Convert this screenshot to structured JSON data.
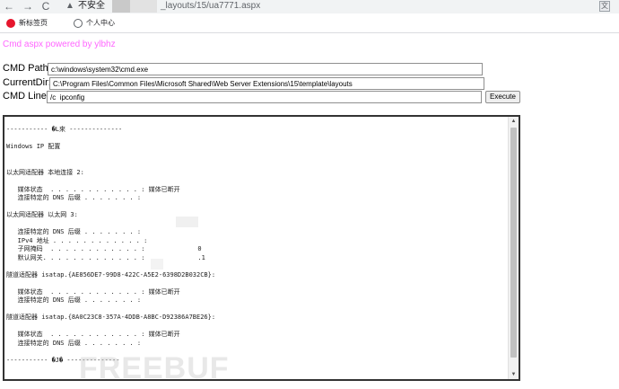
{
  "browser": {
    "back_glyph": "←",
    "forward_glyph": "→",
    "reload_glyph": "C",
    "security_icon": "warning-triangle-icon",
    "security_icon_glyph": "▲",
    "security_text": "不安全",
    "url_tail": "_layouts/15/ua7771.aspx",
    "translate_icon_glyph": "文"
  },
  "bookmarks": [
    {
      "label": "新标签页",
      "icon": "weibo-icon"
    },
    {
      "label": "个人中心",
      "icon": "globe-icon"
    }
  ],
  "page": {
    "brand": "Cmd aspx powered by ylbhz",
    "brand_color": "#ff66ff",
    "cmd_path_label": "CMD Path:",
    "cmd_path_value": "c:\\windows\\system32\\cmd.exe",
    "current_dir_label": "CurrentDir:",
    "current_dir_value": "C:\\Program Files\\Common Files\\Microsoft Shared\\Web Server Extensions\\15\\template\\layouts",
    "cmd_line_label": "CMD Line:",
    "cmd_line_value": "/c  ipconfig",
    "execute_label": "Execute",
    "output": "----------- �L來 --------------\n\nWindows IP 配置\n\n\n以太网适配器 本地连接 2:\n\n   媒体状态  . . . . . . . . . . . . : 媒体已断开\n   连接特定的 DNS 后缀 . . . . . . . :\n\n以太网适配器 以太网 3:\n\n   连接特定的 DNS 后缀 . . . . . . . :\n   IPv4 地址 . . . . . . . . . . . . :\n   子网掩码  . . . . . . . . . . . . :              0\n   默认网关. . . . . . . . . . . . . :              .1\n\n隧道适配器 isatap.{AE856DE7-99D8-422C-A5E2-6398D2B032CB}:\n\n   媒体状态  . . . . . . . . . . . . : 媒体已断开\n   连接特定的 DNS 后缀 . . . . . . . :\n\n隧道适配器 isatap.{8A0C23C8-357A-4DDB-A8BC-D92386A7BE26}:\n\n   媒体状态  . . . . . . . . . . . . : 媒体已断开\n   连接特定的 DNS 后缀 . . . . . . . :\n\n----------- �J� --------------",
    "watermark": "FREEBUF"
  }
}
